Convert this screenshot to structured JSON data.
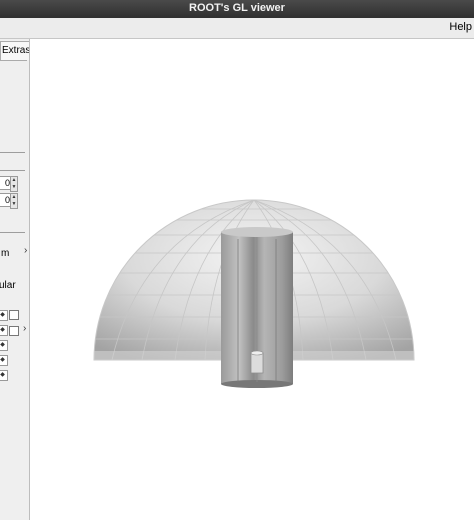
{
  "window": {
    "title": "ROOT's GL viewer"
  },
  "menubar": {
    "help_label": "Help"
  },
  "side_panel": {
    "tab_extras_label": "Extras",
    "spinner_1_value": "0",
    "spinner_2_value": "0",
    "label_partial_1": "m",
    "label_partial_2": "ular"
  },
  "scene": {
    "object": "hemisphere with cylinder",
    "colors": {
      "dome_light": "#e9e9e9",
      "dome_shadow": "#a9a9a9",
      "cylinder": "#9a9a9a",
      "background": "#ffffff"
    }
  }
}
